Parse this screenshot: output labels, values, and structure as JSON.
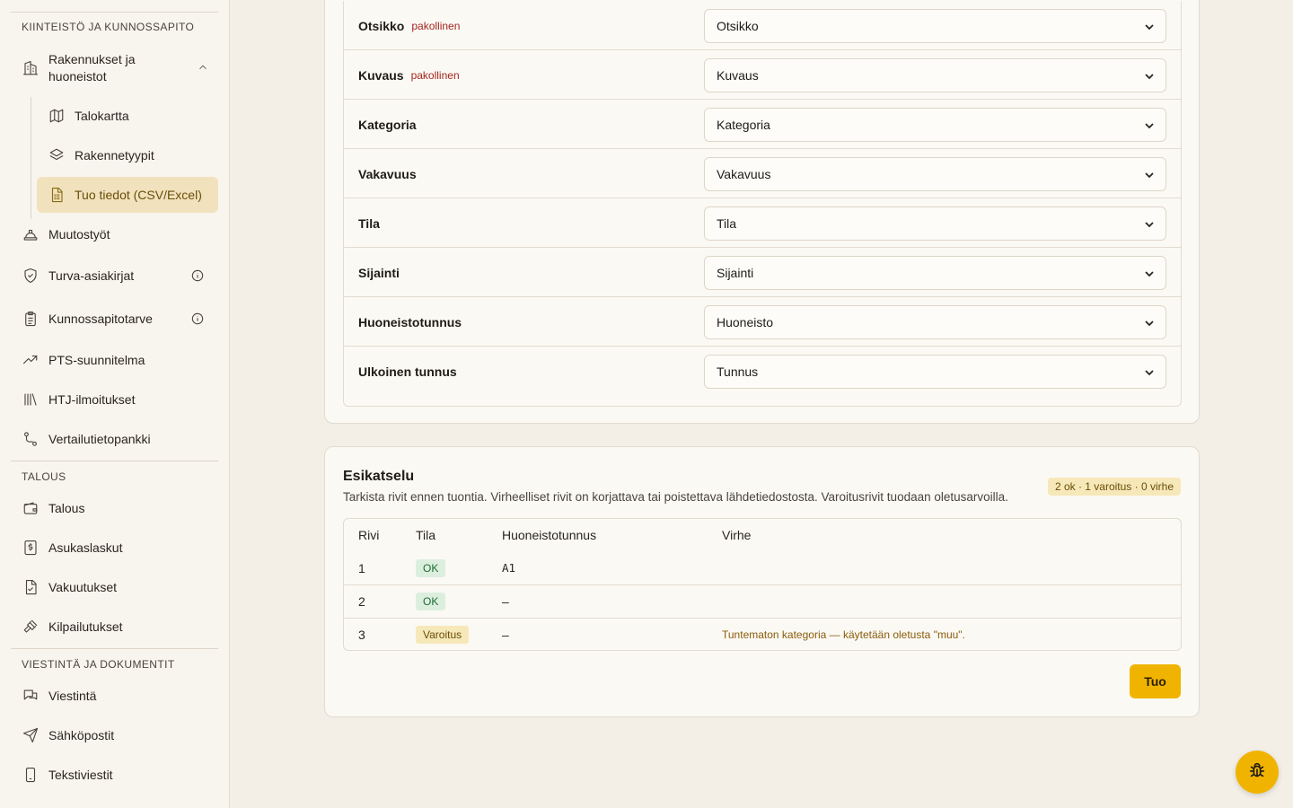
{
  "sidebar": {
    "sections": [
      {
        "label": "KIINTEISTÖ JA KUNNOSSAPITO"
      },
      {
        "label": "TALOUS"
      },
      {
        "label": "VIESTINTÄ JA DOKUMENTIT"
      }
    ],
    "group": {
      "label": "Rakennukset ja huoneistot",
      "icon": "building-icon",
      "expanded": true
    },
    "sub_items": [
      {
        "label": "Talokartta",
        "icon": "map-icon"
      },
      {
        "label": "Rakennetyypit",
        "icon": "layers-icon"
      },
      {
        "label": "Tuo tiedot (CSV/Excel)",
        "icon": "spreadsheet-icon",
        "active": true
      }
    ],
    "items": [
      {
        "label": "Muutostyöt",
        "icon": "hard-hat-icon"
      },
      {
        "label": "Turva-asiakirjat",
        "icon": "shield-icon",
        "info": true
      },
      {
        "label": "Kunnossapitotarve",
        "icon": "clipboard-icon",
        "info": true
      },
      {
        "label": "PTS-suunnitelma",
        "icon": "trend-icon"
      },
      {
        "label": "HTJ-ilmoitukset",
        "icon": "library-icon"
      },
      {
        "label": "Vertailutietopankki",
        "icon": "route-icon"
      },
      {
        "label": "Talous",
        "icon": "wallet-icon"
      },
      {
        "label": "Asukaslaskut",
        "icon": "invoice-icon"
      },
      {
        "label": "Vakuutukset",
        "icon": "file-check-icon"
      },
      {
        "label": "Kilpailutukset",
        "icon": "gavel-icon"
      },
      {
        "label": "Viestintä",
        "icon": "chat-icon"
      },
      {
        "label": "Sähköpostit",
        "icon": "send-icon"
      },
      {
        "label": "Tekstiviestit",
        "icon": "phone-icon"
      }
    ]
  },
  "mapping": {
    "required_label": "pakollinen",
    "rows": [
      {
        "label": "Otsikko",
        "required": true,
        "value": "Otsikko"
      },
      {
        "label": "Kuvaus",
        "required": true,
        "value": "Kuvaus"
      },
      {
        "label": "Kategoria",
        "required": false,
        "value": "Kategoria"
      },
      {
        "label": "Vakavuus",
        "required": false,
        "value": "Vakavuus"
      },
      {
        "label": "Tila",
        "required": false,
        "value": "Tila"
      },
      {
        "label": "Sijainti",
        "required": false,
        "value": "Sijainti"
      },
      {
        "label": "Huoneistotunnus",
        "required": false,
        "value": "Huoneisto"
      },
      {
        "label": "Ulkoinen tunnus",
        "required": false,
        "value": "Tunnus"
      }
    ]
  },
  "preview": {
    "title": "Esikatselu",
    "description": "Tarkista rivit ennen tuontia. Virheelliset rivit on korjattava tai poistettava lähdetiedostosta. Varoitusrivit tuodaan oletusarvoilla.",
    "summary_badge": "2 ok · 1 varoitus · 0 virhe",
    "columns": [
      "Rivi",
      "Tila",
      "Huoneistotunnus",
      "Virhe"
    ],
    "rows": [
      {
        "rivi": "1",
        "tila": "OK",
        "status": "ok",
        "huoneisto": "A1",
        "virhe": ""
      },
      {
        "rivi": "2",
        "tila": "OK",
        "status": "ok",
        "huoneisto": "–",
        "virhe": ""
      },
      {
        "rivi": "3",
        "tila": "Varoitus",
        "status": "warn",
        "huoneisto": "–",
        "virhe": "Tuntematon kategoria — käytetään oletusta \"muu\"."
      }
    ],
    "import_button": "Tuo"
  },
  "fab": {
    "icon": "bug-icon"
  },
  "colors": {
    "accent": "#f0b400",
    "active_bg": "#f1e2bd",
    "required": "#a3261e",
    "ok_bg": "#dcefdf",
    "warn_bg": "#f6e8b8"
  }
}
